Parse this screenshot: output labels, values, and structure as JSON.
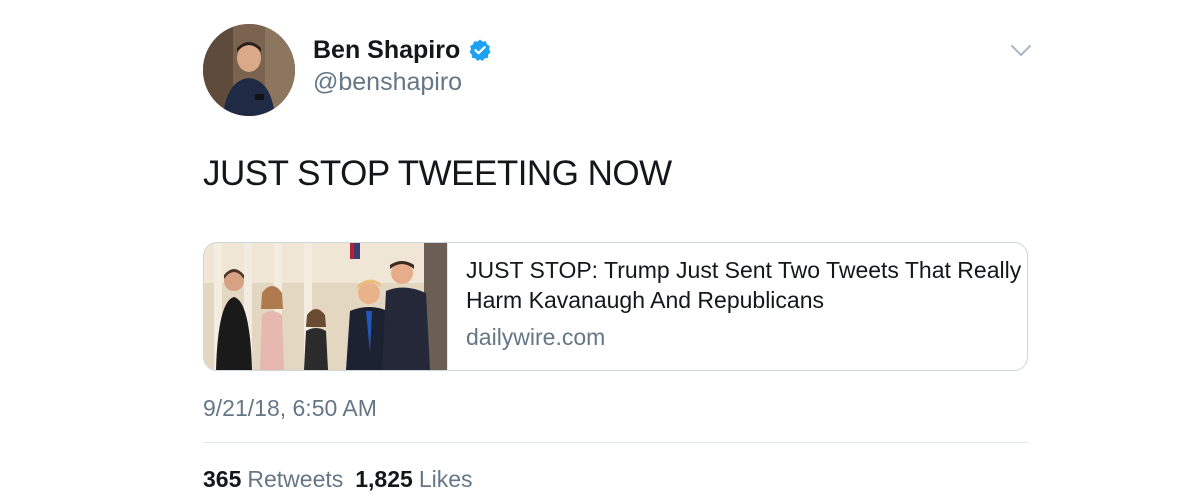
{
  "author": {
    "name": "Ben Shapiro",
    "handle": "@benshapiro",
    "verified": true
  },
  "tweet": {
    "text": "JUST STOP TWEETING NOW",
    "timestamp": "9/21/18, 6:50 AM"
  },
  "card": {
    "title": "JUST STOP: Trump Just Sent Two Tweets That Really Harm Kavanaugh And Republicans",
    "domain": "dailywire.com"
  },
  "stats": {
    "retweets_count": "365",
    "retweets_label": "Retweets",
    "likes_count": "1,825",
    "likes_label": "Likes"
  },
  "icons": {
    "verified": "verified-badge-icon",
    "menu": "chevron-down-icon"
  },
  "colors": {
    "verified_blue": "#1da1f2",
    "secondary_text": "#657786",
    "primary_text": "#14171a",
    "border": "#ccd6dd"
  }
}
